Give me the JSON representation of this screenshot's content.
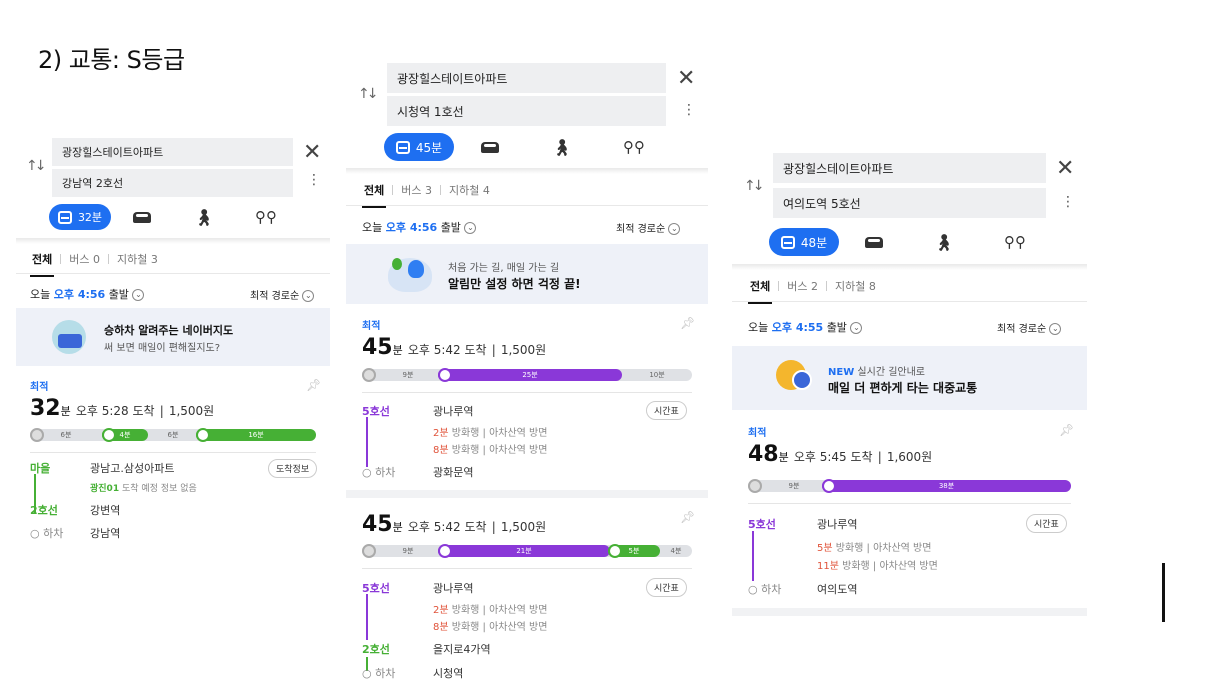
{
  "slide": {
    "title": "2) 교통: S등급"
  },
  "panels": [
    {
      "from": "광장힐스테이트아파트",
      "to": "강남역 2호선",
      "mode_time": "32분",
      "tabs": [
        "전체",
        "버스 0",
        "지하철 3"
      ],
      "depart_prefix": "오늘",
      "depart_time": "오후 4:56",
      "depart_suffix": "출발",
      "sort": "최적 경로순",
      "banner_line1": "승하차 알려주는 네이버지도",
      "banner_line2": "써 보면 매일이 편해질지도?",
      "badge": "최적",
      "duration_num": "32",
      "duration_unit": "분",
      "arrive": "오후 5:28 도착",
      "fare": "1,500원",
      "segments": [
        "6분",
        "4분",
        "6분",
        "16분"
      ],
      "steps": [
        {
          "line": "마을",
          "station": "광남고.삼성아파트",
          "button": "도착정보"
        },
        {
          "sub_line": "광진01",
          "sub_text": "도착 예정 정보 없음"
        },
        {
          "line": "2호선",
          "station": "강변역"
        },
        {
          "line": "하차",
          "station": "강남역"
        }
      ]
    },
    {
      "from": "광장힐스테이트아파트",
      "to": "시청역 1호선",
      "mode_time": "45분",
      "tabs": [
        "전체",
        "버스 3",
        "지하철 4"
      ],
      "depart_prefix": "오늘",
      "depart_time": "오후 4:56",
      "depart_suffix": "출발",
      "sort": "최적 경로순",
      "banner_line1": "처음 가는 길, 매일 가는 길",
      "banner_line2": "알림만 설정 하면 걱정 끝!",
      "routes": [
        {
          "badge": "최적",
          "duration_num": "45",
          "duration_unit": "분",
          "arrive": "오후 5:42 도착",
          "fare": "1,500원",
          "segments": [
            "9분",
            "25분",
            "10분"
          ],
          "line": "5호선",
          "station": "광나루역",
          "button": "시간표",
          "next1_min": "2분",
          "next1_text": "방화행 | 아차산역 방면",
          "next2_min": "8분",
          "next2_text": "방화행 | 아차산역 방면",
          "end_label": "하차",
          "end_station": "광화문역"
        },
        {
          "duration_num": "45",
          "duration_unit": "분",
          "arrive": "오후 5:42 도착",
          "fare": "1,500원",
          "segments": [
            "9분",
            "21분",
            "5분",
            "4분"
          ],
          "line": "5호선",
          "station": "광나루역",
          "button": "시간표",
          "next1_min": "2분",
          "next1_text": "방화행 | 아차산역 방면",
          "next2_min": "8분",
          "next2_text": "방화행 | 아차산역 방면",
          "line2": "2호선",
          "station2": "을지로4가역",
          "end_label": "하차",
          "end_station": "시청역"
        }
      ]
    },
    {
      "from": "광장힐스테이트아파트",
      "to": "여의도역 5호선",
      "mode_time": "48분",
      "tabs": [
        "전체",
        "버스 2",
        "지하철 8"
      ],
      "depart_prefix": "오늘",
      "depart_time": "오후 4:55",
      "depart_suffix": "출발",
      "sort": "최적 경로순",
      "banner_new": "NEW",
      "banner_line1": "실시간 길안내로",
      "banner_line2": "매일 더 편하게 타는 대중교통",
      "badge": "최적",
      "duration_num": "48",
      "duration_unit": "분",
      "arrive": "오후 5:45 도착",
      "fare": "1,600원",
      "segments": [
        "9분",
        "38분"
      ],
      "line": "5호선",
      "station": "광나루역",
      "button": "시간표",
      "next1_min": "5분",
      "next1_text": "방화행 | 아차산역 방면",
      "next2_min": "11분",
      "next2_text": "방화행 | 아차산역 방면",
      "end_label": "하차",
      "end_station": "여의도역"
    }
  ],
  "colors": {
    "accent": "#1e6ff1",
    "line5": "#8a38d8",
    "line2": "#46b035",
    "minutes": "#e0533a"
  }
}
